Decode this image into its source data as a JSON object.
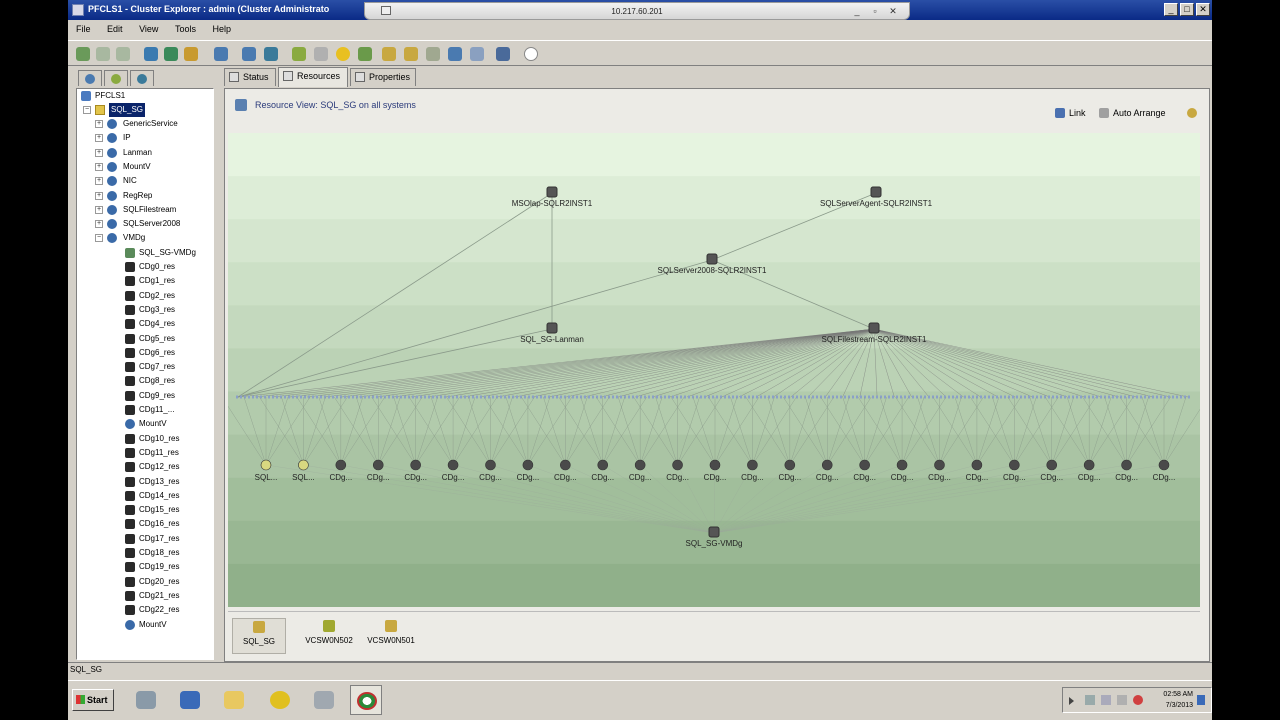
{
  "window": {
    "title": "PFCLS1 - Cluster Explorer : admin (Cluster Administrato",
    "rdp_title": "10.217.60.201"
  },
  "menu": [
    "File",
    "Edit",
    "View",
    "Tools",
    "Help"
  ],
  "tree": {
    "root": "PFCLS1",
    "group": "SQL_SG",
    "types": [
      "GenericService",
      "IP",
      "Lanman",
      "MountV",
      "NIC",
      "RegRep",
      "SQLFilestream",
      "SQLServer2008",
      "VMDg"
    ],
    "children": [
      "SQL_SG-VMDg",
      "CDg0_res",
      "CDg1_res",
      "CDg2_res",
      "CDg3_res",
      "CDg4_res",
      "CDg5_res",
      "CDg6_res",
      "CDg7_res",
      "CDg8_res",
      "CDg9_res",
      "CDg11_...",
      "MountV",
      "CDg10_res",
      "CDg11_res",
      "CDg12_res",
      "CDg13_res",
      "CDg14_res",
      "CDg15_res",
      "CDg16_res",
      "CDg17_res",
      "CDg18_res",
      "CDg19_res",
      "CDg20_res",
      "CDg21_res",
      "CDg22_res",
      "MountV"
    ]
  },
  "tabs": [
    "Status",
    "Resources",
    "Properties"
  ],
  "resource_view": {
    "title": "Resource View: SQL_SG on all systems",
    "link_label": "Link",
    "auto_arrange_label": "Auto Arrange"
  },
  "graph": {
    "nodes_top": [
      {
        "label": "MSOlap-SQLR2INST1"
      },
      {
        "label": "SQLServerAgent-SQLR2INST1"
      },
      {
        "label": "SQLServer2008-SQLR2INST1"
      },
      {
        "label": "SQL_SG-Lanman"
      },
      {
        "label": "SQLFilestream-SQLR2INST1"
      },
      {
        "label": "SQL_SG-VMDg"
      }
    ],
    "leaf_labels": [
      "SQL...",
      "SQL...",
      "CDg...",
      "CDg...",
      "CDg...",
      "CDg...",
      "CDg...",
      "CDg...",
      "CDg...",
      "CDg...",
      "CDg...",
      "CDg...",
      "CDg...",
      "CDg...",
      "CDg...",
      "CDg...",
      "CDg...",
      "CDg...",
      "CDg...",
      "CDg...",
      "CDg...",
      "CDg...",
      "CDg...",
      "CDg...",
      "CDg..."
    ]
  },
  "systems": [
    {
      "label": "SQL_SG"
    },
    {
      "label": "VCSW0N502"
    },
    {
      "label": "VCSW0N501"
    }
  ],
  "status_text": "SQL_SG",
  "taskbar": {
    "start_label": "Start",
    "time": "02:58 AM",
    "date": "7/3/2013"
  },
  "colors": {
    "title_bar": "#0a2a86",
    "graph_bg_top": "#e6f4e0",
    "graph_bg_bottom": "#8fb08a",
    "selection": "#0a246a"
  }
}
